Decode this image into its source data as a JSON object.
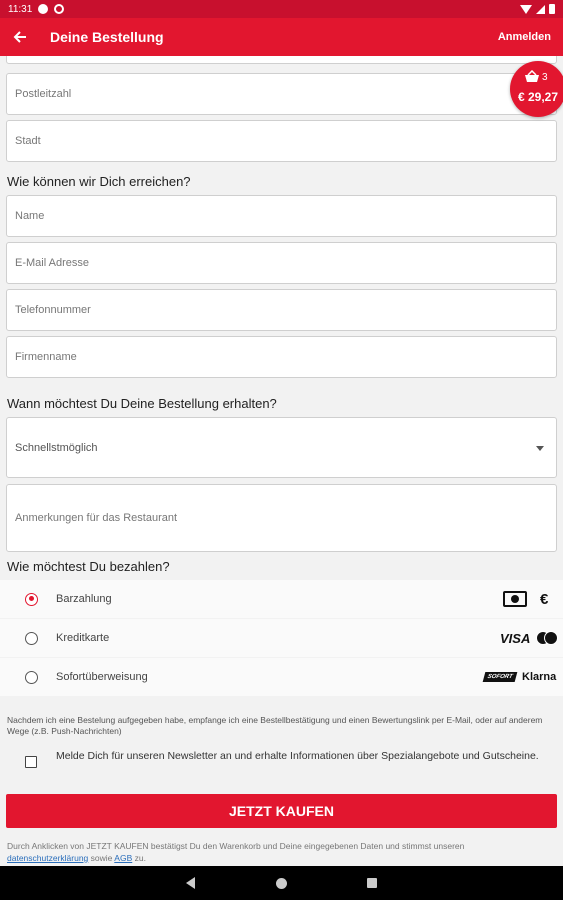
{
  "status_bar": {
    "time": "11:31"
  },
  "app_bar": {
    "title": "Deine Bestellung",
    "login_label": "Anmelden"
  },
  "cart_badge": {
    "count": "3",
    "total": "€ 29,27"
  },
  "address": {
    "postcode_placeholder": "Postleitzahl",
    "city_placeholder": "Stadt"
  },
  "contact": {
    "heading": "Wie können wir Dich erreichen?",
    "name_placeholder": "Name",
    "email_placeholder": "E-Mail Adresse",
    "phone_placeholder": "Telefonnummer",
    "company_placeholder": "Firmenname"
  },
  "delivery": {
    "heading": "Wann möchtest Du Deine Bestellung erhalten?",
    "time_selected": "Schnellstmöglich",
    "remarks_placeholder": "Anmerkungen für das Restaurant"
  },
  "payment": {
    "heading": "Wie möchtest Du bezahlen?",
    "options": [
      {
        "label": "Barzahlung",
        "selected": true,
        "icons": [
          "cash-icon",
          "euro-icon"
        ],
        "icon_text": "€"
      },
      {
        "label": "Kreditkarte",
        "selected": false,
        "icons": [
          "visa-logo",
          "mastercard-logo"
        ],
        "icon_text": "VISA"
      },
      {
        "label": "Sofortüberweisung",
        "selected": false,
        "icons": [
          "sofort-logo",
          "klarna-logo"
        ],
        "icon_text": "Klarna",
        "sofort_text": "SOFORT"
      }
    ]
  },
  "confirmation_notice": "Nachdem ich eine Bestelung aufgegeben habe, empfange ich eine Bestellbestätigung und einen Bewertungslink per E-Mail, oder auf anderem Wege (z.B. Push-Nachrichten)",
  "newsletter": {
    "label": "Melde Dich für unseren Newsletter an und erhalte Informationen über Spezialangebote und Gutscheine.",
    "checked": false
  },
  "buy_button": "JETZT KAUFEN",
  "terms": {
    "text_before": "Durch Anklicken von JETZT KAUFEN bestätigst Du den Warenkorb und Deine eingegebenen Daten und stimmst unseren",
    "privacy_link": "datenschutzerklärung",
    "text_middle": "sowie",
    "agb_link": "AGB",
    "text_after": "zu."
  },
  "colors": {
    "brand_red": "#e2162f",
    "status_red": "#c8102e"
  }
}
